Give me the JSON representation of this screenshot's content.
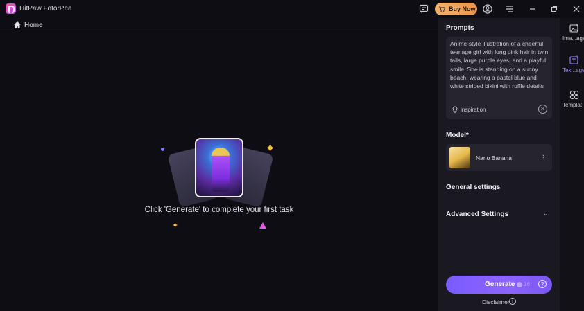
{
  "app": {
    "title": "HitPaw FotorPea"
  },
  "titlebar": {
    "buy_label": "Buy Now",
    "icons": [
      "feedback-icon",
      "cart-icon",
      "account-icon",
      "menu-icon",
      "minimize-icon",
      "maximize-icon",
      "close-icon"
    ]
  },
  "nav": {
    "home_label": "Home"
  },
  "main": {
    "empty_message": "Click 'Generate' to complete your first task"
  },
  "panel": {
    "prompts_title": "Prompts",
    "prompt_text": "Anime-style illustration of a cheerful teenage girl with long pink hair in twin tails, large purple eyes, and a playful smile. She is standing on a sunny beach, wearing a pastel blue and white striped bikini with ruffle details",
    "inspiration_label": "inspiration",
    "model_title": "Model*",
    "model_name": "Nano Banana",
    "general_settings": "General settings",
    "advanced_settings": "Advanced Settings",
    "generate_label": "Generate",
    "credit_count": "16",
    "disclaimer": "Disclaimer"
  },
  "rail": {
    "items": [
      {
        "label": "Ima...age",
        "icon": "image-icon",
        "active": false
      },
      {
        "label": "Tex...age",
        "icon": "text-to-image-icon",
        "active": true
      },
      {
        "label": "Templat",
        "icon": "template-icon",
        "active": false
      }
    ]
  },
  "colors": {
    "background": "#0f0d14",
    "panel": "#1a1820",
    "accent": "#8e63ff",
    "buy_button": "#f3b26b"
  }
}
